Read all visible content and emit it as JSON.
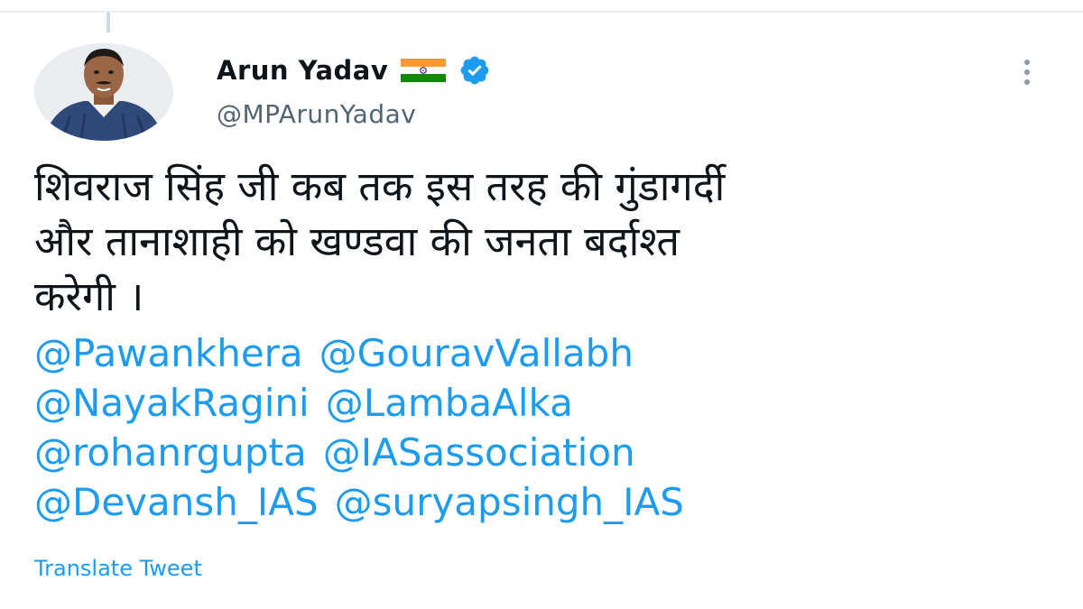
{
  "author": {
    "display_name": "Arun Yadav",
    "handle": "@MPArunYadav",
    "flag_icon": "india-flag-icon",
    "verified_icon": "verified-badge-icon",
    "verified_color": "#1d9bf0"
  },
  "tweet": {
    "lines": [
      "शिवराज सिंह जी कब तक इस तरह की गुंडागर्दी",
      "और तानाशाही को खण्डवा की जनता बर्दाश्त",
      "करेगी ।"
    ],
    "mention_lines": [
      [
        "@Pawankhera",
        "@GouravVallabh"
      ],
      [
        "@NayakRagini",
        "@LambaAlka"
      ],
      [
        "@rohanrgupta",
        "@IASassociation"
      ],
      [
        "@Devansh_IAS",
        "@suryapsingh_IAS"
      ]
    ],
    "translate_label": "Translate Tweet"
  },
  "actions": {
    "more_icon": "more-options-icon"
  },
  "colors": {
    "link": "#1d9bf0",
    "text": "#0f1419",
    "secondary": "#536471"
  }
}
